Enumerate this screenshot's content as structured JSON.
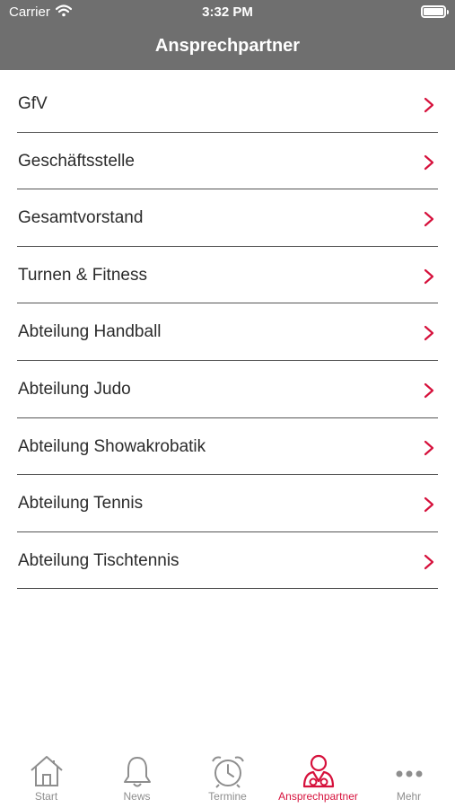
{
  "status_bar": {
    "carrier": "Carrier",
    "time": "3:32 PM"
  },
  "header": {
    "title": "Ansprechpartner"
  },
  "list": {
    "items": [
      {
        "label": "GfV"
      },
      {
        "label": "Geschäftsstelle"
      },
      {
        "label": "Gesamtvorstand"
      },
      {
        "label": "Turnen & Fitness"
      },
      {
        "label": "Abteilung Handball"
      },
      {
        "label": "Abteilung Judo"
      },
      {
        "label": "Abteilung Showakrobatik"
      },
      {
        "label": "Abteilung Tennis"
      },
      {
        "label": "Abteilung Tischtennis"
      }
    ]
  },
  "tabbar": {
    "tabs": [
      {
        "label": "Start",
        "icon": "home-icon"
      },
      {
        "label": "News",
        "icon": "bell-icon"
      },
      {
        "label": "Termine",
        "icon": "alarm-clock-icon"
      },
      {
        "label": "Ansprechpartner",
        "icon": "contact-person-icon",
        "active": true
      },
      {
        "label": "Mehr",
        "icon": "more-dots-icon"
      }
    ]
  },
  "colors": {
    "accent": "#d6113c",
    "header_bg": "#6f6f6f",
    "inactive": "#8e8e8e"
  }
}
